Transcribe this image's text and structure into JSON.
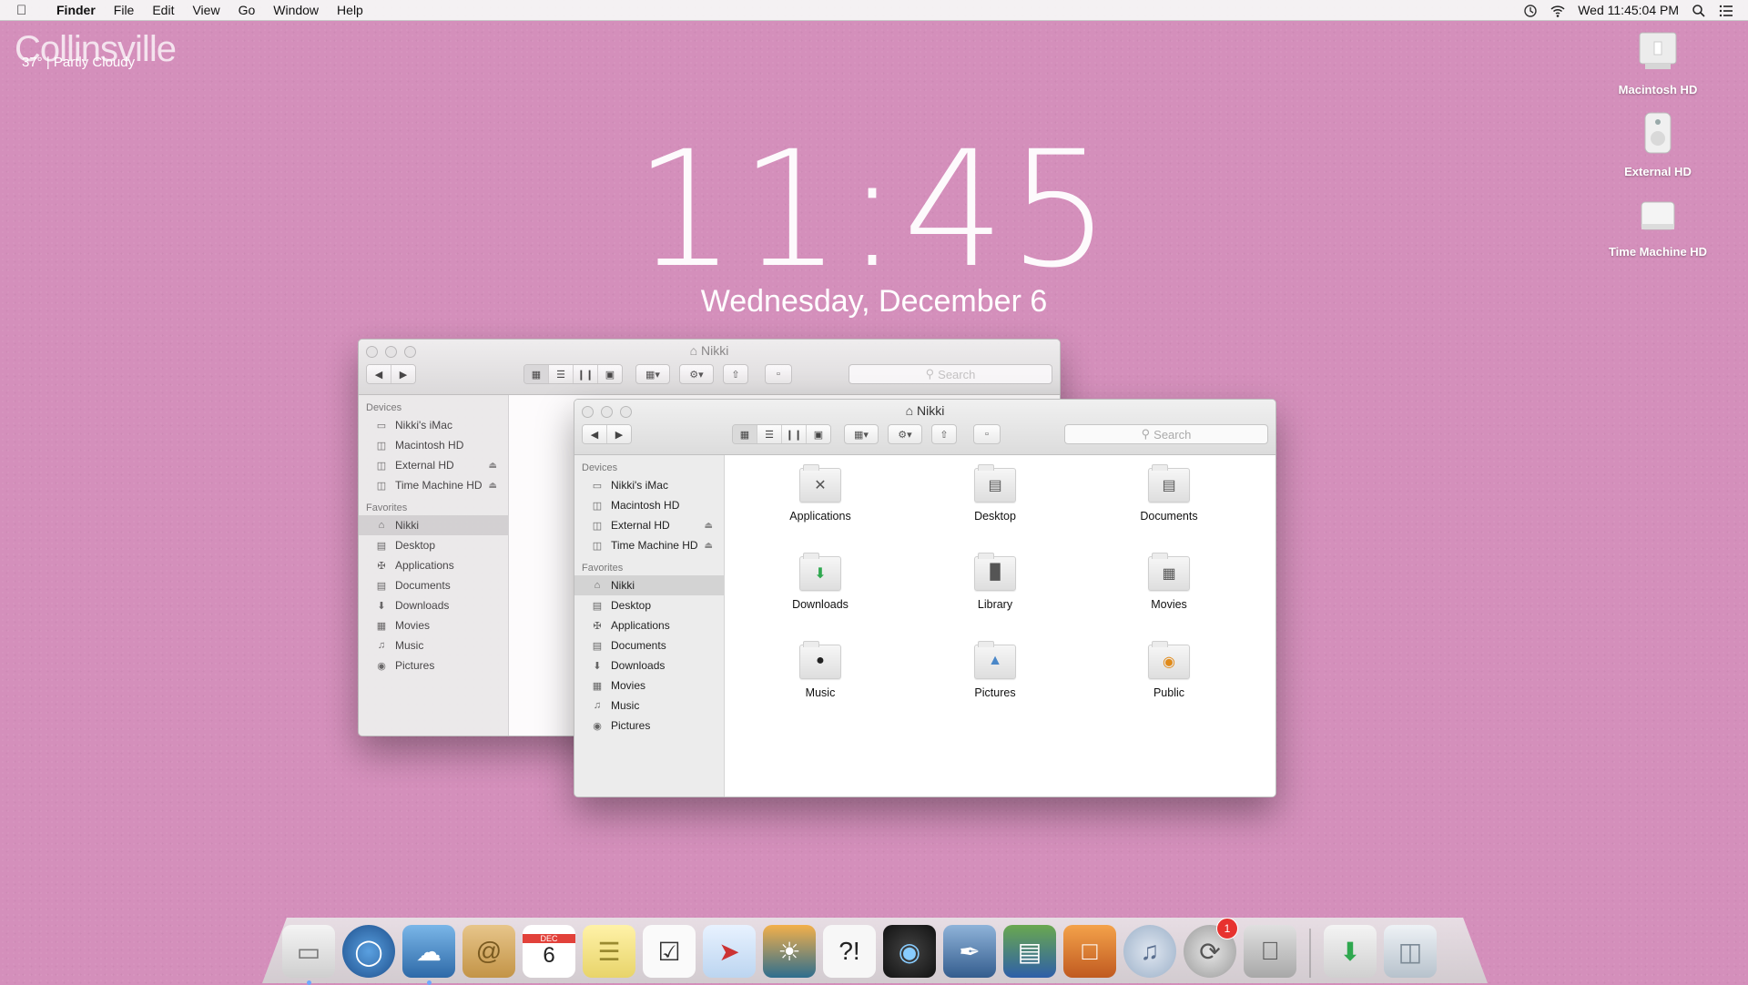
{
  "menubar": {
    "app_name": "Finder",
    "items": [
      "File",
      "Edit",
      "View",
      "Go",
      "Window",
      "Help"
    ],
    "clock": "Wed 11:45:04 PM"
  },
  "weather": {
    "city": "Collinsville",
    "condition": "37° | Partly Cloudy"
  },
  "lockclock": {
    "time": "11:45",
    "date": "Wednesday, December 6"
  },
  "desktop_icons": [
    {
      "label": "Macintosh HD"
    },
    {
      "label": "External HD"
    },
    {
      "label": "Time Machine HD"
    }
  ],
  "back_window": {
    "title": "Nikki",
    "search_placeholder": "Search",
    "sidebar": {
      "devices_heading": "Devices",
      "devices": [
        "Nikki's iMac",
        "Macintosh HD",
        "External HD",
        "Time Machine HD"
      ],
      "favorites_heading": "Favorites",
      "favorites": [
        "Nikki",
        "Desktop",
        "Applications",
        "Documents",
        "Downloads",
        "Movies",
        "Music",
        "Pictures"
      ]
    }
  },
  "front_window": {
    "title": "Nikki",
    "search_placeholder": "Search",
    "sidebar": {
      "devices_heading": "Devices",
      "devices": [
        "Nikki's iMac",
        "Macintosh HD",
        "External HD",
        "Time Machine HD"
      ],
      "favorites_heading": "Favorites",
      "favorites": [
        "Nikki",
        "Desktop",
        "Applications",
        "Documents",
        "Downloads",
        "Movies",
        "Music",
        "Pictures"
      ]
    },
    "folders": [
      "Applications",
      "Desktop",
      "Documents",
      "Downloads",
      "Library",
      "Movies",
      "Music",
      "Pictures",
      "Public"
    ]
  },
  "dock": {
    "calendar_month": "DEC",
    "calendar_day": "6",
    "badge_count": "1"
  }
}
